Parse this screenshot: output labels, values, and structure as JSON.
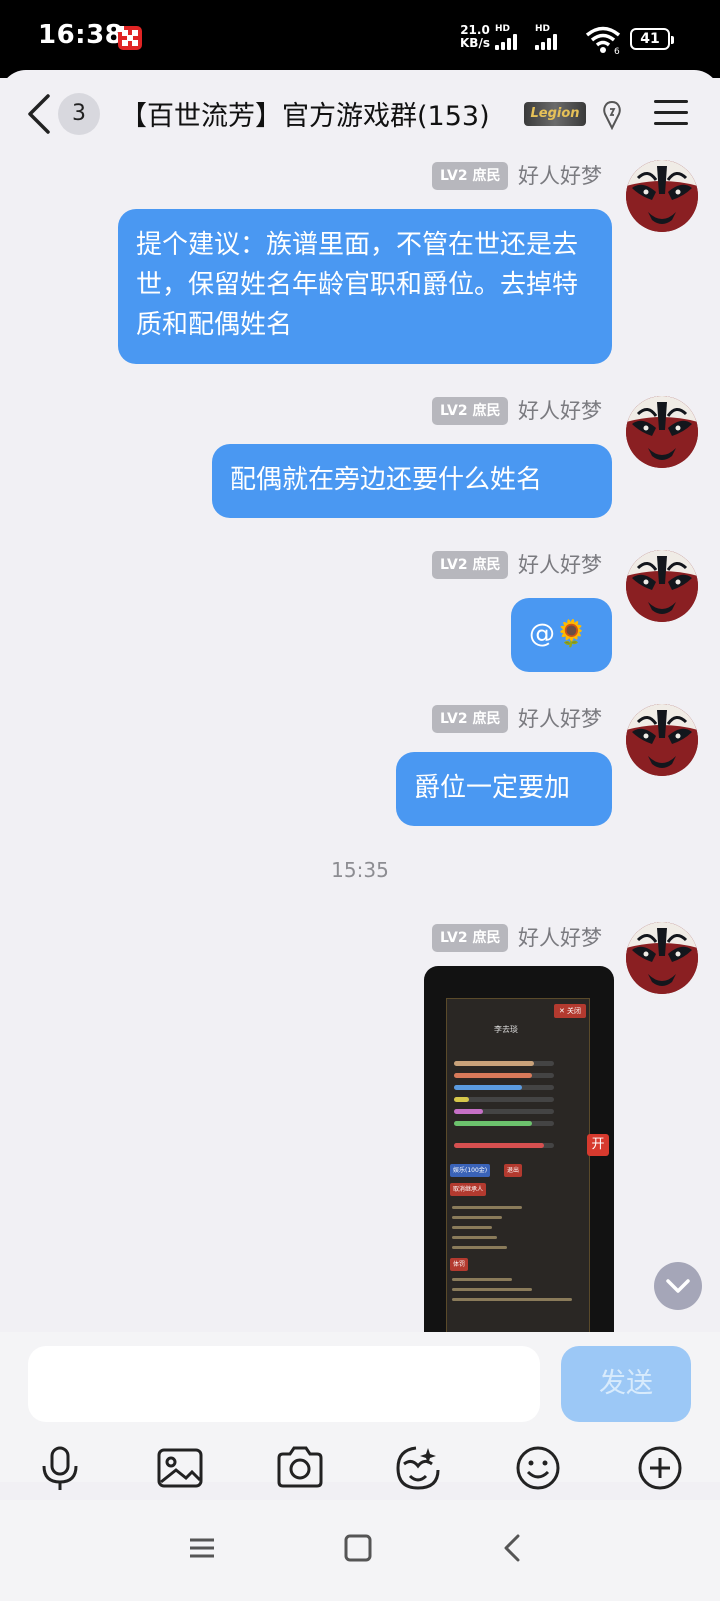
{
  "status_bar": {
    "time": "16:38",
    "net_speed_value": "21.0",
    "net_speed_unit": "KB/s",
    "sim1_label": "HD",
    "sim2_label": "HD",
    "wifi_sub": "6",
    "battery": "41"
  },
  "header": {
    "unread_count": "3",
    "title": "【百世流芳】官方游戏群(153)",
    "legion_badge": "Legion"
  },
  "messages": [
    {
      "level": "LV2 庶民",
      "sender": "好人好梦",
      "text": "提个建议：族谱里面，不管在世还是去世，保留姓名年龄官职和爵位。去掉特质和配偶姓名"
    },
    {
      "level": "LV2 庶民",
      "sender": "好人好梦",
      "text": "配偶就在旁边还要什么姓名"
    },
    {
      "level": "LV2 庶民",
      "sender": "好人好梦",
      "text": "@🌻"
    },
    {
      "level": "LV2 庶民",
      "sender": "好人好梦",
      "text": "爵位一定要加"
    },
    {
      "level": "LV2 庶民",
      "sender": "好人好梦",
      "image": "game-screenshot"
    }
  ],
  "timestamp": "15:35",
  "screenshot": {
    "close_label": "✕ 关闭",
    "character_name": "李去琰",
    "open_tag": "开",
    "btn_entertain": "娱乐(100金)",
    "btn_exit": "退出",
    "btn_cancel_heir": "取消继承人",
    "btn_punish": "体罚",
    "stats": [
      76,
      74,
      65,
      14,
      28,
      75
    ],
    "stat_colors": [
      "#c9a27a",
      "#d87a5a",
      "#5b9be0",
      "#d6c84a",
      "#c670c6",
      "#6cc26c"
    ]
  },
  "input": {
    "placeholder": "",
    "send_label": "发送"
  },
  "toolbar": [
    "microphone-icon",
    "image-icon",
    "camera-icon",
    "sticker-icon",
    "emoji-icon",
    "plus-icon"
  ]
}
